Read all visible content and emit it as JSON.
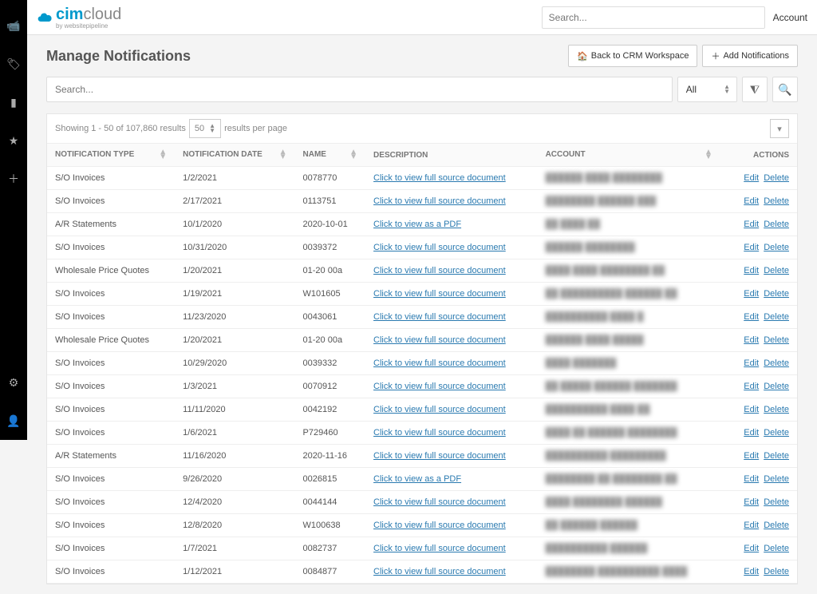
{
  "brand": {
    "primary": "cim",
    "secondary": "cloud",
    "subtitle": "by websitepipeline"
  },
  "topbar": {
    "search_placeholder": "Search...",
    "account_label": "Account"
  },
  "sidebar": {
    "items": [
      "video-icon",
      "tag-icon",
      "doc-icon",
      "star-icon",
      "plus-icon",
      "gear-icon",
      "user-icon"
    ]
  },
  "page": {
    "title": "Manage Notifications",
    "back_label": "Back to CRM Workspace",
    "add_label": "Add Notifications"
  },
  "filter": {
    "search_placeholder": "Search...",
    "scope_label": "All"
  },
  "table_top": {
    "showing": "Showing 1 - 50 of 107,860 results",
    "per_page_value": "50",
    "per_page_suffix": "results per page"
  },
  "columns": {
    "type": "NOTIFICATION TYPE",
    "date": "NOTIFICATION DATE",
    "name": "NAME",
    "description": "DESCRIPTION",
    "account": "ACCOUNT",
    "actions": "ACTIONS"
  },
  "actions": {
    "edit": "Edit",
    "delete": "Delete"
  },
  "desc_links": {
    "doc": "Click to view full source document",
    "pdf": "Click to view as a PDF"
  },
  "rows": [
    {
      "type": "S/O Invoices",
      "date": "1/2/2021",
      "name": "0078770",
      "desc": "doc",
      "account": "██████ ████ ████████"
    },
    {
      "type": "S/O Invoices",
      "date": "2/17/2021",
      "name": "0113751",
      "desc": "doc",
      "account": "████████ ██████ ███"
    },
    {
      "type": "A/R Statements",
      "date": "10/1/2020",
      "name": "2020-10-01",
      "desc": "pdf",
      "account": "██ ████ ██"
    },
    {
      "type": "S/O Invoices",
      "date": "10/31/2020",
      "name": "0039372",
      "desc": "doc",
      "account": "██████ ████████"
    },
    {
      "type": "Wholesale Price Quotes",
      "date": "1/20/2021",
      "name": "01-20 00a",
      "desc": "doc",
      "account": "████ ████ ████████ ██"
    },
    {
      "type": "S/O Invoices",
      "date": "1/19/2021",
      "name": "W101605",
      "desc": "doc",
      "account": "██ ██████████ ██████ ██"
    },
    {
      "type": "S/O Invoices",
      "date": "11/23/2020",
      "name": "0043061",
      "desc": "doc",
      "account": "██████████ ████ █"
    },
    {
      "type": "Wholesale Price Quotes",
      "date": "1/20/2021",
      "name": "01-20 00a",
      "desc": "doc",
      "account": "██████ ████ █████"
    },
    {
      "type": "S/O Invoices",
      "date": "10/29/2020",
      "name": "0039332",
      "desc": "doc",
      "account": "████ ███████"
    },
    {
      "type": "S/O Invoices",
      "date": "1/3/2021",
      "name": "0070912",
      "desc": "doc",
      "account": "██ █████ ██████ ███████"
    },
    {
      "type": "S/O Invoices",
      "date": "11/11/2020",
      "name": "0042192",
      "desc": "doc",
      "account": "██████████ ████ ██"
    },
    {
      "type": "S/O Invoices",
      "date": "1/6/2021",
      "name": "P729460",
      "desc": "doc",
      "account": "████ ██ ██████ ████████"
    },
    {
      "type": "A/R Statements",
      "date": "11/16/2020",
      "name": "2020-11-16",
      "desc": "doc",
      "account": "██████████ █████████"
    },
    {
      "type": "S/O Invoices",
      "date": "9/26/2020",
      "name": "0026815",
      "desc": "pdf",
      "account": "████████ ██ ████████ ██"
    },
    {
      "type": "S/O Invoices",
      "date": "12/4/2020",
      "name": "0044144",
      "desc": "doc",
      "account": "████ ████████ ██████"
    },
    {
      "type": "S/O Invoices",
      "date": "12/8/2020",
      "name": "W100638",
      "desc": "doc",
      "account": "██ ██████ ██████"
    },
    {
      "type": "S/O Invoices",
      "date": "1/7/2021",
      "name": "0082737",
      "desc": "doc",
      "account": "██████████ ██████"
    },
    {
      "type": "S/O Invoices",
      "date": "1/12/2021",
      "name": "0084877",
      "desc": "doc",
      "account": "████████ ██████████ ████"
    }
  ]
}
